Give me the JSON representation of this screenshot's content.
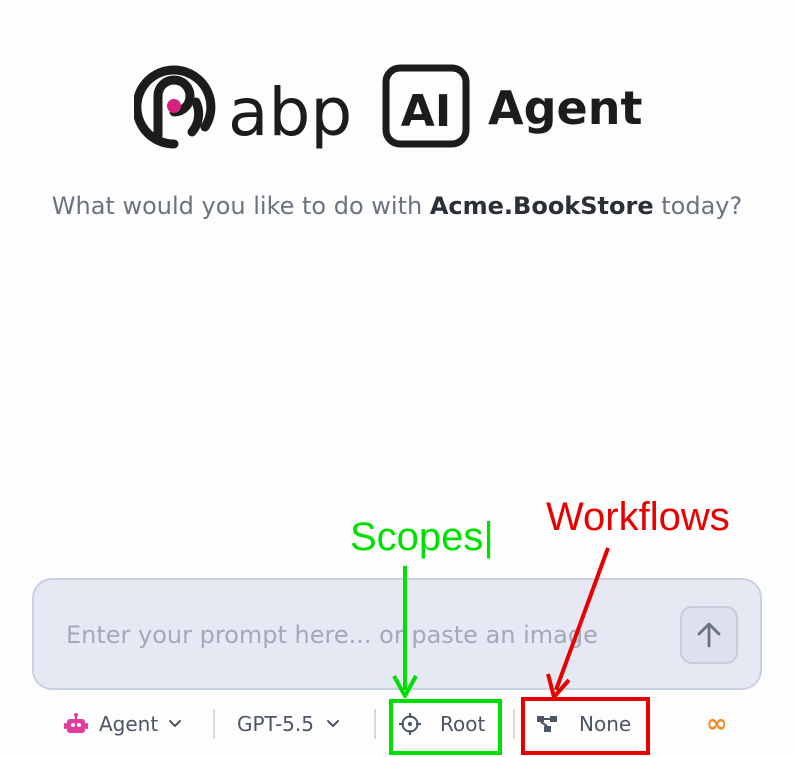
{
  "brand": {
    "wordmark": "abp",
    "ai_badge": "AI",
    "product": "Agent"
  },
  "subtitle": {
    "prefix": "What would you like to do with ",
    "project": "Acme.BookStore",
    "suffix": " today?"
  },
  "prompt": {
    "placeholder": "Enter your prompt here... or paste an image"
  },
  "toolbar": {
    "mode_label": "Agent",
    "model_label": "GPT-5.5",
    "scope_label": "Root",
    "workflow_label": "None",
    "credits_symbol": "∞"
  },
  "annotations": {
    "scopes_label": "Scopes|",
    "workflows_label": "Workflows"
  },
  "colors": {
    "brand_dot": "#d6217e",
    "agent_icon": "#e23c9a",
    "infinity": "#f08c28",
    "annotation_green": "#00e000",
    "annotation_red": "#e80000"
  }
}
